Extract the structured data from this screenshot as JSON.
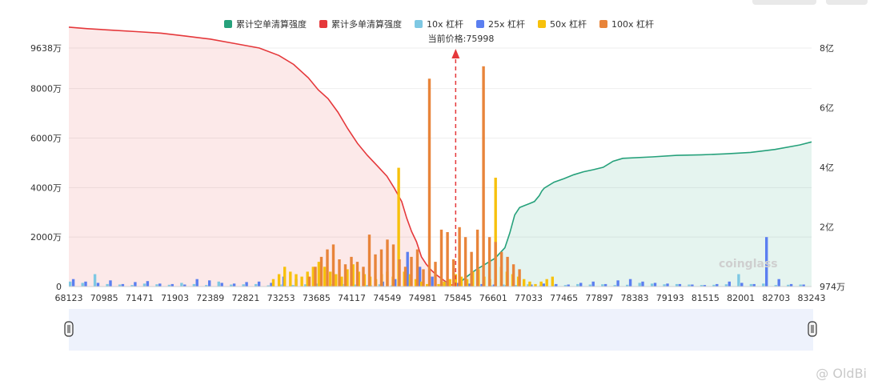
{
  "legend": [
    {
      "name": "累计空单清算强度",
      "color": "#26a17b"
    },
    {
      "name": "累计多单清算强度",
      "color": "#e5383b"
    },
    {
      "name": "10x 杠杆",
      "color": "#7ec8e3"
    },
    {
      "name": "25x 杠杆",
      "color": "#5b7ff0"
    },
    {
      "name": "50x 杠杆",
      "color": "#f7c10c"
    },
    {
      "name": "100x 杠杆",
      "color": "#e8843a"
    }
  ],
  "current_price_label": "当前价格:75998",
  "brand_watermark": "coinglass",
  "user_watermark": "@ OldBi",
  "chart_data": {
    "type": "bar",
    "current_price": 75998,
    "x_tick_labels": [
      "68123",
      "70985",
      "71471",
      "71903",
      "72389",
      "72821",
      "73253",
      "73685",
      "74117",
      "74549",
      "74981",
      "75845",
      "76601",
      "77033",
      "77465",
      "77897",
      "78383",
      "79193",
      "81515",
      "82001",
      "82703",
      "83243"
    ],
    "left_axis": {
      "unit": "万",
      "range": [
        0,
        9638
      ],
      "ticks": [
        "0",
        "2000万",
        "4000万",
        "6000万",
        "8000万",
        "9638万"
      ]
    },
    "right_axis": {
      "unit": "亿",
      "range": [
        0,
        8
      ],
      "ticks": [
        "974万",
        "2亿",
        "4亿",
        "6亿",
        "8亿"
      ]
    },
    "series": [
      {
        "name": "累计多单清算强度",
        "type": "area",
        "x": [
          68123,
          68500,
          69000,
          69500,
          70000,
          70500,
          71000,
          71500,
          72000,
          72400,
          72700,
          73000,
          73200,
          73400,
          73600,
          73800,
          74000,
          74200,
          74400,
          74600,
          74750,
          74900,
          75000,
          75100,
          75200,
          75300,
          75400,
          75500,
          75600,
          75700,
          75850,
          75998
        ],
        "values": [
          8.7,
          8.65,
          8.6,
          8.55,
          8.5,
          8.4,
          8.3,
          8.15,
          8.0,
          7.75,
          7.45,
          7.0,
          6.6,
          6.3,
          5.85,
          5.3,
          4.8,
          4.4,
          4.05,
          3.7,
          3.3,
          2.85,
          2.3,
          1.85,
          1.5,
          1.0,
          0.75,
          0.55,
          0.4,
          0.28,
          0.1,
          0
        ]
      },
      {
        "name": "累计空单清算强度",
        "type": "area",
        "x": [
          75998,
          76200,
          76400,
          76600,
          76800,
          77000,
          77100,
          77200,
          77300,
          77400,
          77500,
          77600,
          77700,
          77750,
          77800,
          78000,
          78200,
          78400,
          78600,
          78800,
          79000,
          79200,
          79400,
          80000,
          80500,
          81000,
          81500,
          82000,
          82500,
          83000,
          83243
        ],
        "values": [
          0,
          0.3,
          0.55,
          0.75,
          0.95,
          1.3,
          1.8,
          2.4,
          2.65,
          2.72,
          2.78,
          2.85,
          3.05,
          3.2,
          3.3,
          3.5,
          3.62,
          3.75,
          3.85,
          3.92,
          4.0,
          4.2,
          4.3,
          4.35,
          4.4,
          4.42,
          4.45,
          4.5,
          4.6,
          4.75,
          4.85
        ]
      },
      {
        "name": "10x 杠杆",
        "levels": [
          200,
          150,
          500,
          100,
          80,
          60,
          120,
          90,
          70,
          150,
          100,
          60,
          200,
          80,
          90,
          100,
          50,
          80,
          60,
          90,
          120,
          70,
          100,
          80,
          60,
          90,
          50,
          70,
          60,
          80,
          100,
          90,
          70,
          60,
          50,
          80,
          60,
          90,
          50,
          70,
          60,
          100,
          80,
          90,
          60,
          70,
          150,
          120,
          90,
          100,
          80,
          60,
          70,
          90,
          500,
          100,
          120,
          60,
          70,
          80
        ]
      },
      {
        "name": "25x 杠杆",
        "levels": [
          300,
          200,
          150,
          250,
          100,
          180,
          220,
          120,
          100,
          80,
          300,
          250,
          150,
          120,
          180,
          200,
          150,
          400,
          300,
          200,
          150,
          100,
          120,
          80,
          60,
          200,
          300,
          1400,
          800,
          400,
          200,
          150,
          120,
          100,
          80,
          60,
          50,
          80,
          120,
          100,
          80,
          150,
          200,
          100,
          250,
          300,
          200,
          150,
          120,
          100,
          80,
          60,
          100,
          200,
          150,
          100,
          2000,
          300,
          100,
          80
        ]
      },
      {
        "name": "50x 杠杆",
        "levels": [
          300,
          500,
          800,
          600,
          500,
          400,
          600,
          800,
          1000,
          800,
          600,
          500,
          400,
          700,
          900,
          600,
          500,
          400,
          300,
          500,
          600,
          400,
          4800,
          600,
          500,
          300,
          200,
          100,
          0,
          100,
          200,
          300,
          500,
          400,
          300,
          600,
          700,
          400,
          300,
          4400,
          800,
          600,
          500,
          400,
          300,
          200,
          100,
          200,
          300,
          400
        ]
      },
      {
        "name": "100x 杠杆",
        "levels": [
          400,
          800,
          1200,
          1500,
          1700,
          1100,
          900,
          1200,
          1000,
          800,
          2100,
          1300,
          1500,
          1900,
          1700,
          1100,
          800,
          1200,
          1500,
          700,
          8400,
          1000,
          2300,
          2200,
          1100,
          2400,
          2000,
          1400,
          2300,
          8900,
          2000,
          1800,
          1400,
          1200,
          900,
          700
        ]
      }
    ]
  }
}
